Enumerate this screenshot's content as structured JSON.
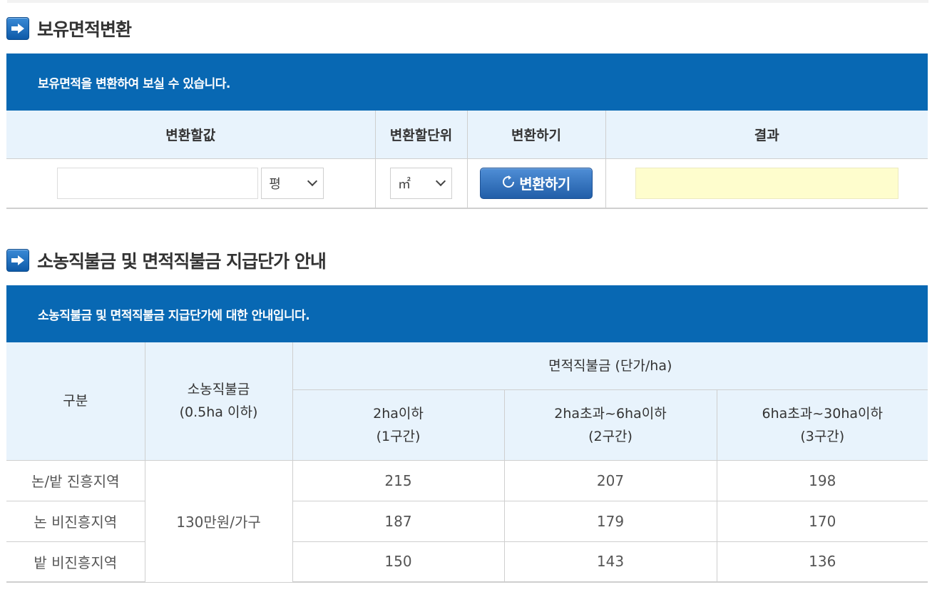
{
  "section1": {
    "title": "보유면적변환",
    "banner": "보유면적을 변환하여 보실 수 있습니다.",
    "headers": [
      "변환할값",
      "변환할단위",
      "변환하기",
      "결과"
    ],
    "input_value": "",
    "from_unit": "평",
    "to_unit": "㎡",
    "convert_button": "변환하기",
    "result": ""
  },
  "section2": {
    "title": "소농직불금 및 면적직불금 지급단가 안내",
    "banner": "소농직불금 및 면적직불금 지급단가에 대한 안내입니다.",
    "header": {
      "category": "구분",
      "small_farm_line1": "소농직불금",
      "small_farm_line2": "(0.5ha 이하)",
      "area_payment": "면적직불금 (단가/ha)",
      "tiers": [
        {
          "line1": "2ha이하",
          "line2": "(1구간)"
        },
        {
          "line1": "2ha초과~6ha이하",
          "line2": "(2구간)"
        },
        {
          "line1": "6ha초과~30ha이하",
          "line2": "(3구간)"
        }
      ]
    },
    "small_farm_amount": "130만원/가구",
    "rows": [
      {
        "region": "논/밭 진흥지역",
        "values": [
          "215",
          "207",
          "198"
        ]
      },
      {
        "region": "논 비진흥지역",
        "values": [
          "187",
          "179",
          "170"
        ]
      },
      {
        "region": "밭 비진흥지역",
        "values": [
          "150",
          "143",
          "136"
        ]
      }
    ]
  },
  "colors": {
    "banner": "#0868b3",
    "header_bg": "#e8f3fc",
    "result_bg": "#fefdcd"
  },
  "icons": [
    "arrow-right-icon",
    "chevron-down-icon",
    "refresh-icon"
  ]
}
